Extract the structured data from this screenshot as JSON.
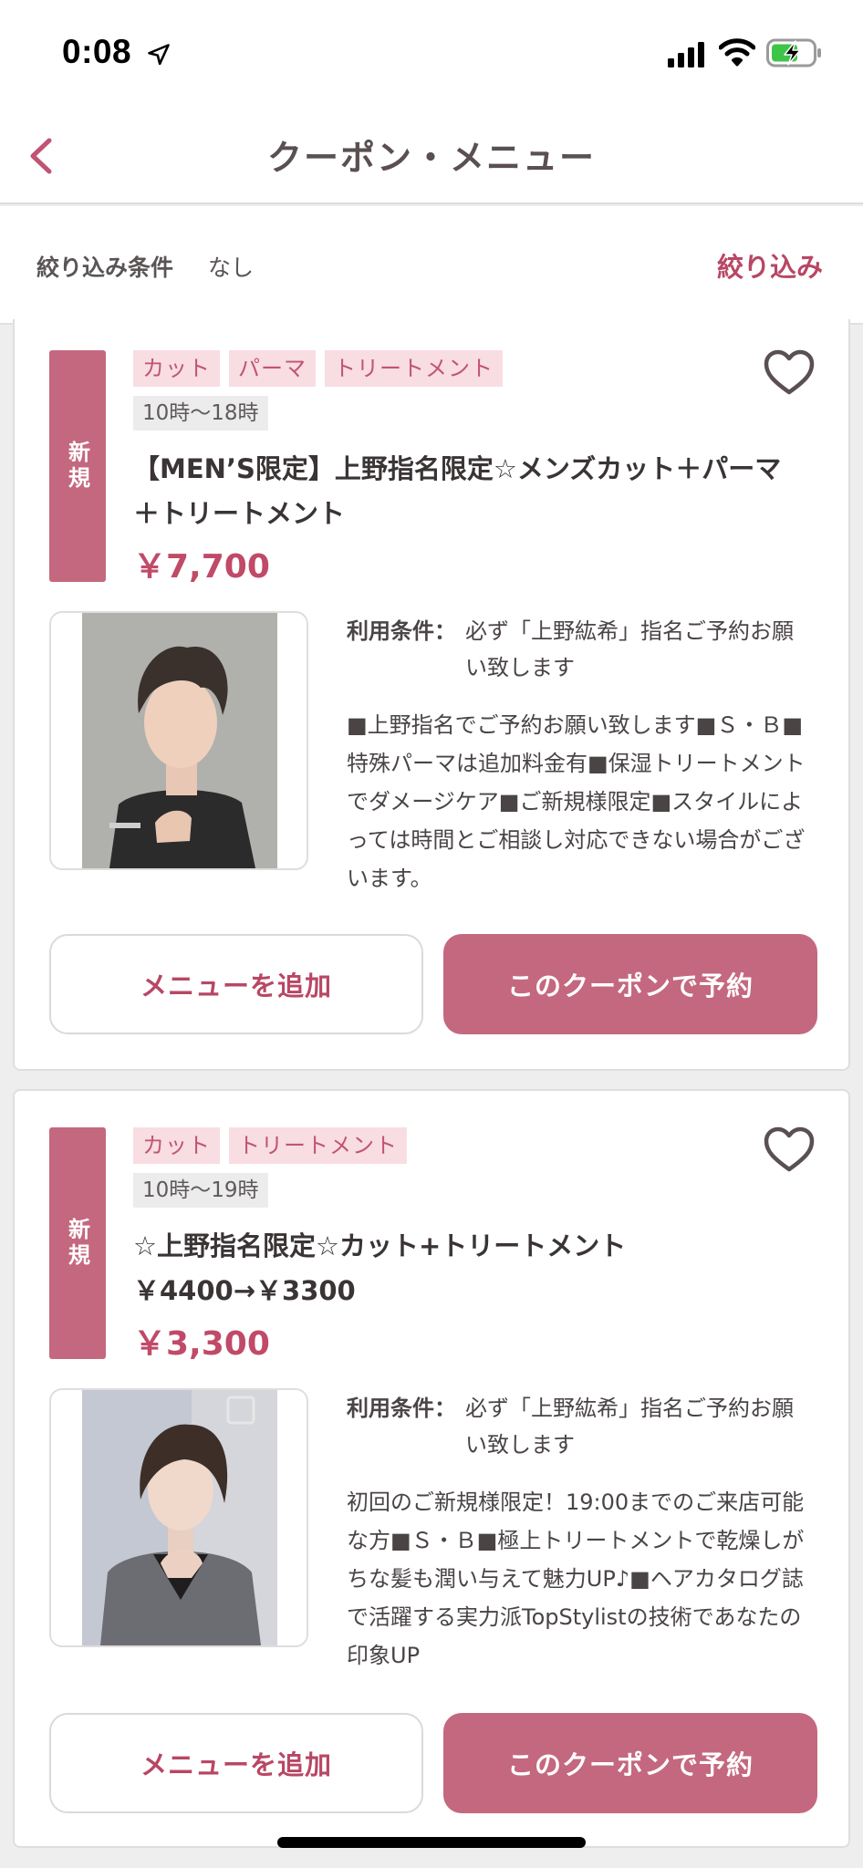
{
  "status_bar": {
    "time": "0:08"
  },
  "header": {
    "title": "クーポン・メニュー"
  },
  "filter": {
    "label": "絞り込み条件",
    "value": "なし",
    "button": "絞り込み"
  },
  "coupons": [
    {
      "badge": "新規",
      "tags": [
        "カット",
        "パーマ",
        "トリートメント"
      ],
      "time": "10時〜18時",
      "title": "【MEN’S限定】上野指名限定☆メンズカット＋パーマ＋トリートメント",
      "price": "￥7,700",
      "condition_label": "利用条件：",
      "condition_text": "必ず「上野紘希」指名ご予約お願い致します",
      "description": "■上野指名でご予約お願い致します■Ｓ・Ｂ■特殊パーマは追加料金有■保湿トリートメントでダメージケア■ご新規様限定■スタイルによっては時間とご相談し対応できない場合がございます。",
      "add_label": "メニューを追加",
      "reserve_label": "このクーポンで予約"
    },
    {
      "badge": "新規",
      "tags": [
        "カット",
        "トリートメント"
      ],
      "time": "10時〜19時",
      "title": "☆上野指名限定☆カット+トリートメント￥4400→￥3300",
      "price": "￥3,300",
      "condition_label": "利用条件：",
      "condition_text": "必ず「上野紘希」指名ご予約お願い致します",
      "description": "初回のご新規様限定！19:00までのご来店可能な方■Ｓ・Ｂ■極上トリートメントで乾燥しがちな髪も潤い与えて魅力UP♪■ヘアカタログ誌で活躍する実力派TopStylistの技術であなたの印象UP",
      "add_label": "メニューを追加",
      "reserve_label": "このクーポンで予約"
    }
  ],
  "colors": {
    "accent": "#c4687f",
    "accent_text": "#b84764",
    "tag_bg": "#f8dde3"
  },
  "icons": [
    "location-arrow-icon",
    "signal-icon",
    "wifi-icon",
    "battery-charging-icon",
    "back-chevron-icon",
    "heart-outline-icon"
  ]
}
